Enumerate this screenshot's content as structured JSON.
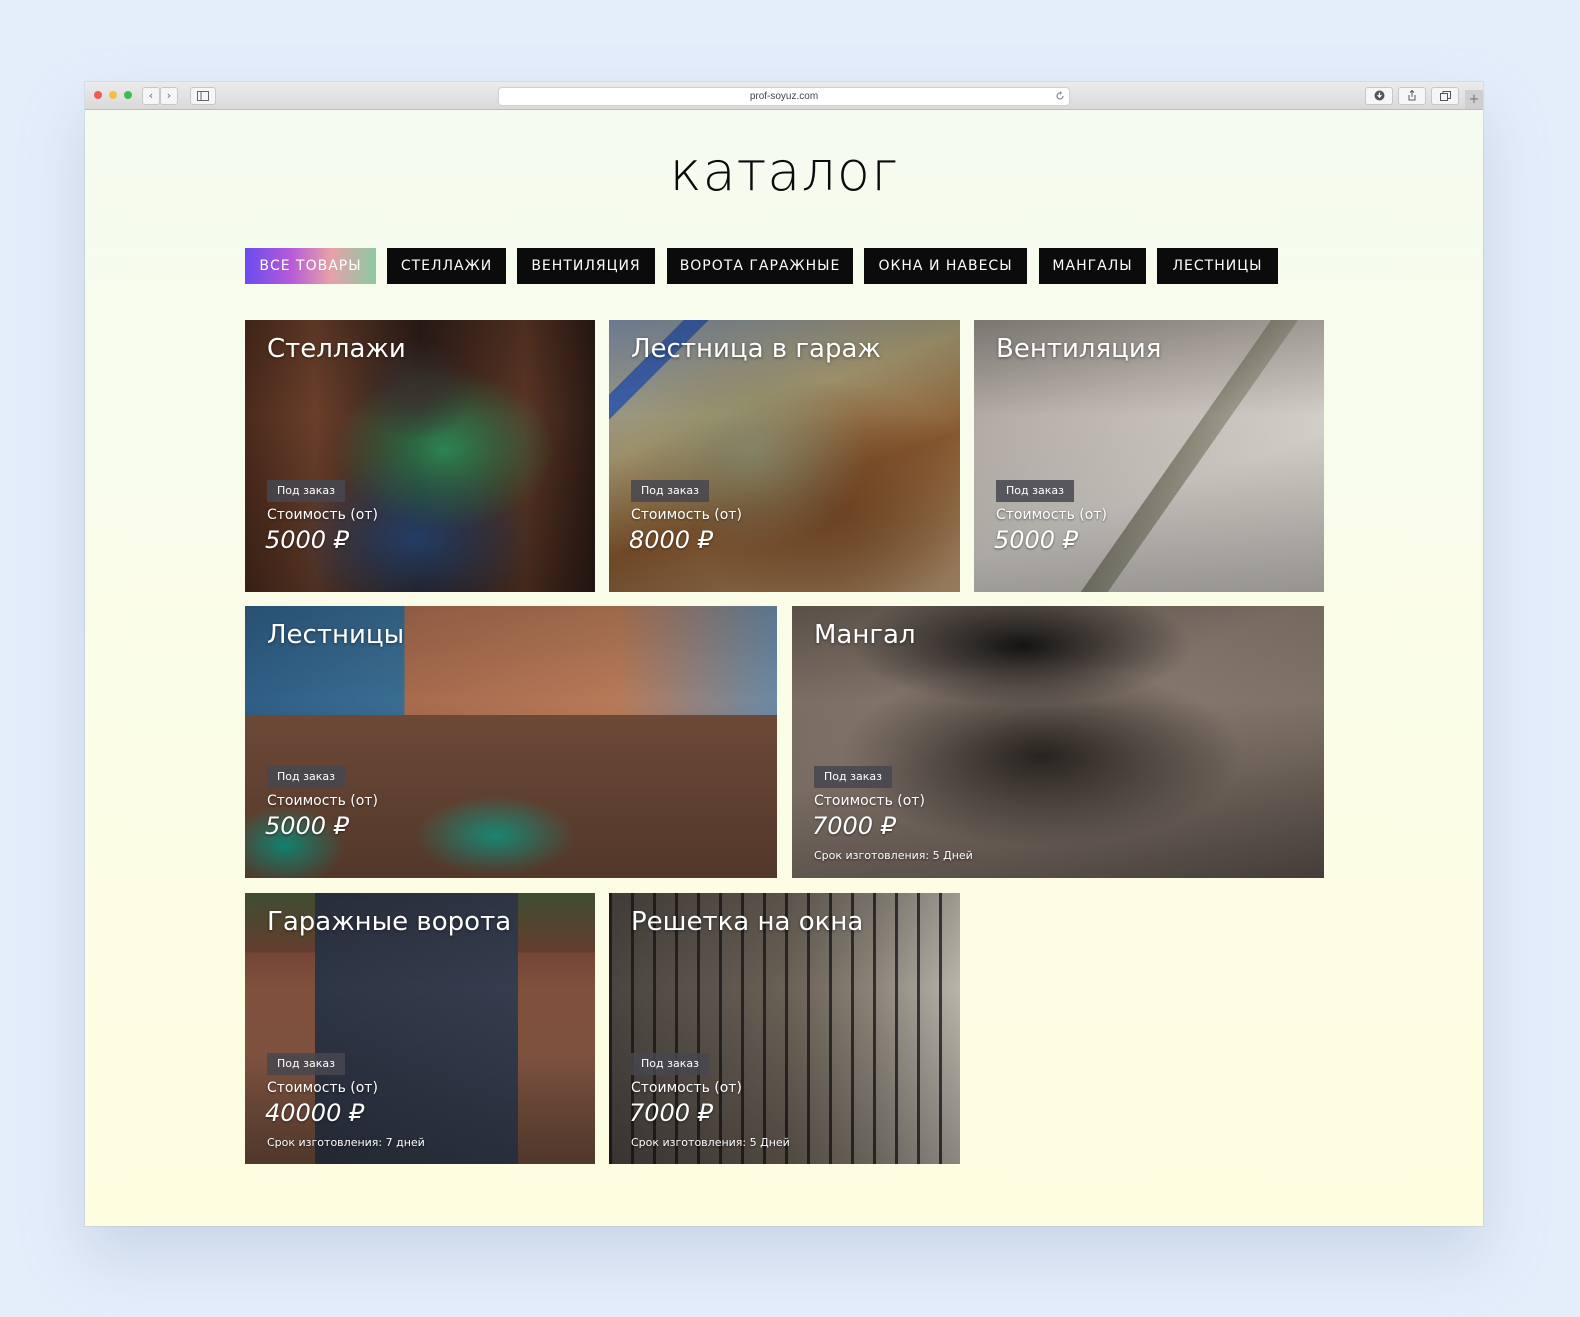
{
  "browser": {
    "url": "prof-soyuz.com",
    "back_icon": "‹",
    "forward_icon": "›"
  },
  "page": {
    "title": "Каталог"
  },
  "filters": [
    {
      "label": "ВСЕ ТОВАРЫ",
      "active": true
    },
    {
      "label": "СТЕЛЛАЖИ",
      "active": false
    },
    {
      "label": "ВЕНТИЛЯЦИЯ",
      "active": false
    },
    {
      "label": "ВОРОТА ГАРАЖНЫЕ",
      "active": false
    },
    {
      "label": "ОКНА И НАВЕСЫ",
      "active": false
    },
    {
      "label": "МАНГАЛЫ",
      "active": false
    },
    {
      "label": "ЛЕСТНИЦЫ",
      "active": false
    }
  ],
  "products": [
    {
      "title": "Стеллажи",
      "badge": "Под заказ",
      "price_label": "Стоимость (от)",
      "price": "5000 ₽",
      "term": ""
    },
    {
      "title": "Лестница в гараж",
      "badge": "Под заказ",
      "price_label": "Стоимость (от)",
      "price": "8000 ₽",
      "term": ""
    },
    {
      "title": "Вентиляция",
      "badge": "Под заказ",
      "price_label": "Стоимость (от)",
      "price": "5000 ₽",
      "term": ""
    },
    {
      "title": "Лестницы",
      "badge": "Под заказ",
      "price_label": "Стоимость (от)",
      "price": "5000 ₽",
      "term": ""
    },
    {
      "title": "Мангал",
      "badge": "Под заказ",
      "price_label": "Стоимость (от)",
      "price": "7000 ₽",
      "term": "Срок изготовления: 5 Дней"
    },
    {
      "title": "Гаражные ворота",
      "badge": "Под заказ",
      "price_label": "Стоимость (от)",
      "price": "40000 ₽",
      "term": "Срок изготовления: 7 дней"
    },
    {
      "title": "Решетка на окна",
      "badge": "Под заказ",
      "price_label": "Стоимость (от)",
      "price": "7000 ₽",
      "term": "Срок изготовления: 5 Дней"
    }
  ],
  "colors": {
    "filter_bg": "#0b0b0b",
    "badge_bg": "#464650",
    "page_bg_top": "#f5fbf0",
    "page_bg_bottom": "#fefde0"
  }
}
